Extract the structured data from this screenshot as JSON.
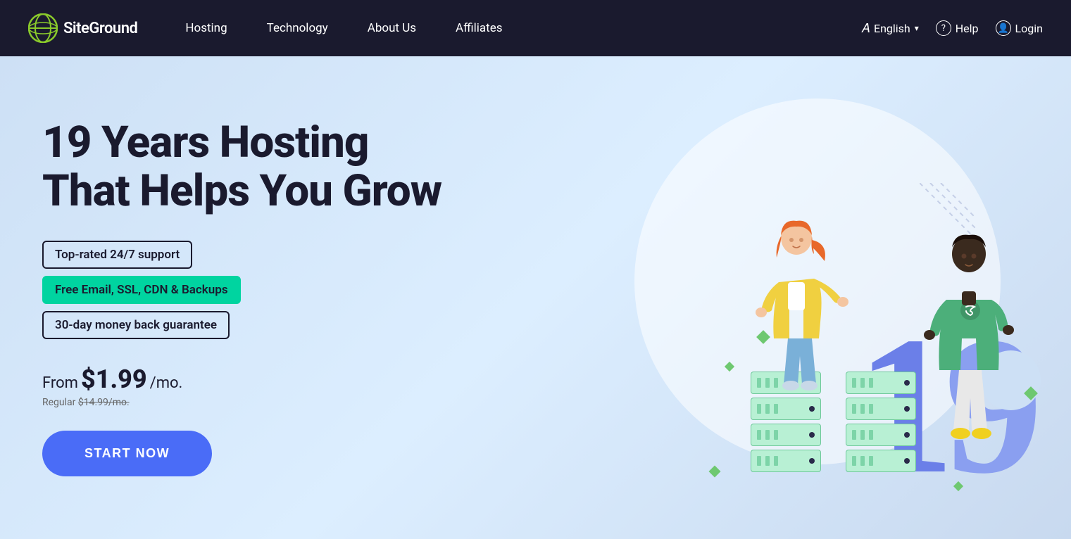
{
  "nav": {
    "logo_text": "SiteGround",
    "links": [
      {
        "label": "Hosting",
        "id": "hosting"
      },
      {
        "label": "Technology",
        "id": "technology"
      },
      {
        "label": "About Us",
        "id": "about-us"
      },
      {
        "label": "Affiliates",
        "id": "affiliates"
      }
    ],
    "language_label": "English",
    "help_label": "Help",
    "login_label": "Login"
  },
  "hero": {
    "title_line1": "19 Years Hosting",
    "title_line2": "That Helps You Grow",
    "badge1": "Top-rated 24/7 support",
    "badge2": "Free Email, SSL, CDN & Backups",
    "badge3": "30-day money back guarantee",
    "pricing_from": "From",
    "pricing_amount": "$1.99",
    "pricing_period": "/mo.",
    "pricing_regular_label": "Regular",
    "pricing_regular_price": "$14.99/mo.",
    "cta_button": "START NOW"
  }
}
